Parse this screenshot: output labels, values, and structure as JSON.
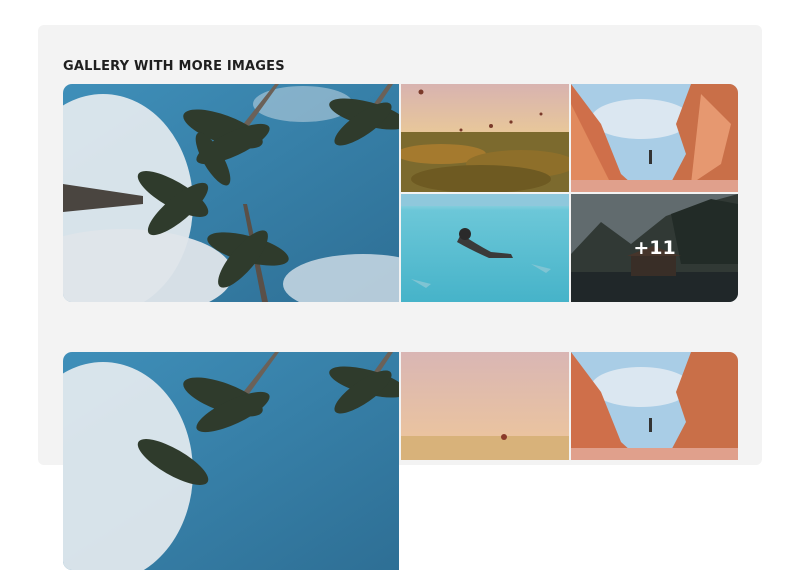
{
  "gallery_title": "GALLERY WITH MORE IMAGES",
  "galleries": [
    {
      "images": [
        {
          "subject": "palm-trees-sky"
        },
        {
          "subject": "hot-air-balloons-valley"
        },
        {
          "subject": "canyon-hiker"
        },
        {
          "subject": "underwater-swimmer"
        },
        {
          "subject": "lake-cabin-mountains"
        }
      ],
      "more_count_label": "+11"
    },
    {
      "images": [
        {
          "subject": "palm-trees-sky"
        },
        {
          "subject": "hot-air-balloons-valley"
        },
        {
          "subject": "canyon-hiker"
        }
      ]
    }
  ]
}
